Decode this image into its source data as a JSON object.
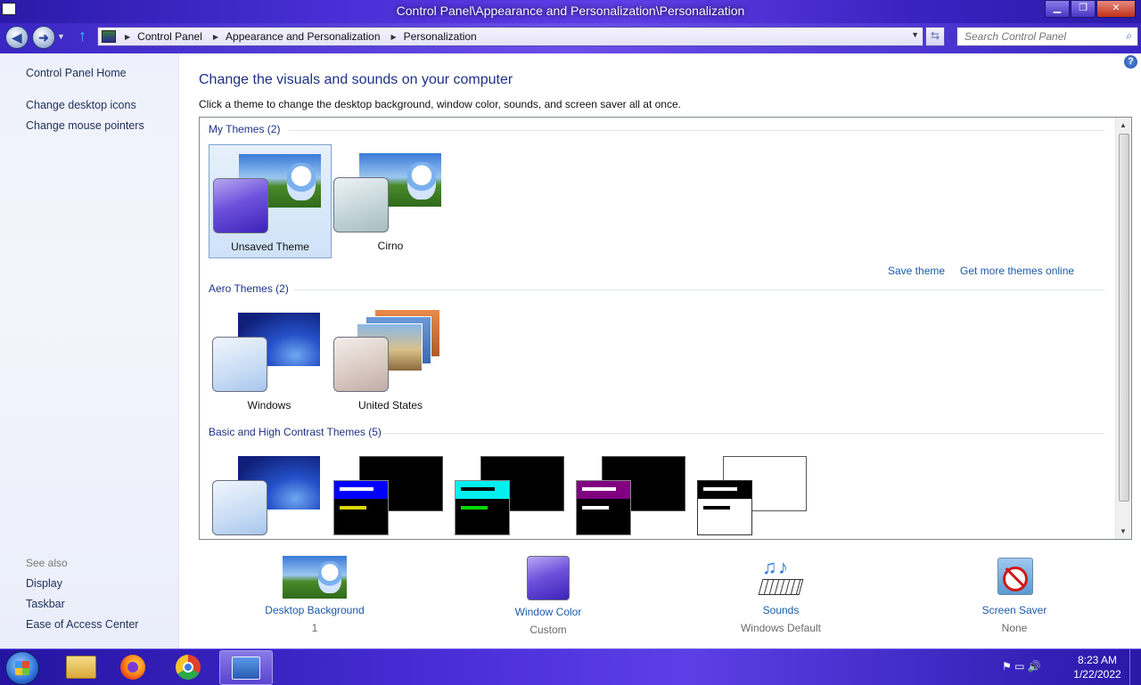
{
  "window": {
    "title": "Control Panel\\Appearance and Personalization\\Personalization",
    "minimize": "▁",
    "maximize": "❐",
    "close": "✕"
  },
  "nav": {
    "back": "◀",
    "forward": "➜",
    "dropdown": "▼",
    "up": "↑",
    "breadcrumbs": [
      "Control Panel",
      "Appearance and Personalization",
      "Personalization"
    ],
    "separator": "▶",
    "refresh": "⇆",
    "search_placeholder": "Search Control Panel",
    "search_icon": "⌕"
  },
  "sidebar": {
    "links": [
      "Control Panel Home",
      "Change desktop icons",
      "Change mouse pointers"
    ],
    "see_also_label": "See also",
    "see_also": [
      "Display",
      "Taskbar",
      "Ease of Access Center"
    ]
  },
  "main": {
    "title": "Change the visuals and sounds on your computer",
    "subtitle": "Click a theme to change the desktop background, window color, sounds, and screen saver all at once.",
    "help": "?"
  },
  "themes": {
    "my_themes_label": "My Themes (2)",
    "my_themes": [
      {
        "name": "Unsaved Theme",
        "selected": true
      },
      {
        "name": "Cirno",
        "selected": false
      }
    ],
    "save_theme": "Save theme",
    "get_more": "Get more themes online",
    "aero_label": "Aero Themes (2)",
    "aero_themes": [
      {
        "name": "Windows"
      },
      {
        "name": "United States"
      }
    ],
    "basic_label": "Basic and High Contrast Themes (5)"
  },
  "bottom": {
    "desktop_background": {
      "label": "Desktop Background",
      "value": "1"
    },
    "window_color": {
      "label": "Window Color",
      "value": "Custom"
    },
    "sounds": {
      "label": "Sounds",
      "value": "Windows Default"
    },
    "screen_saver": {
      "label": "Screen Saver",
      "value": "None"
    }
  },
  "taskbar": {
    "tray_icons": "⚑ ▭ 🔊",
    "time": "8:23 AM",
    "date": "1/22/2022"
  },
  "colors": {
    "accent": "#4a2fd6",
    "link": "#1b5aa8",
    "heading": "#1e3287"
  }
}
